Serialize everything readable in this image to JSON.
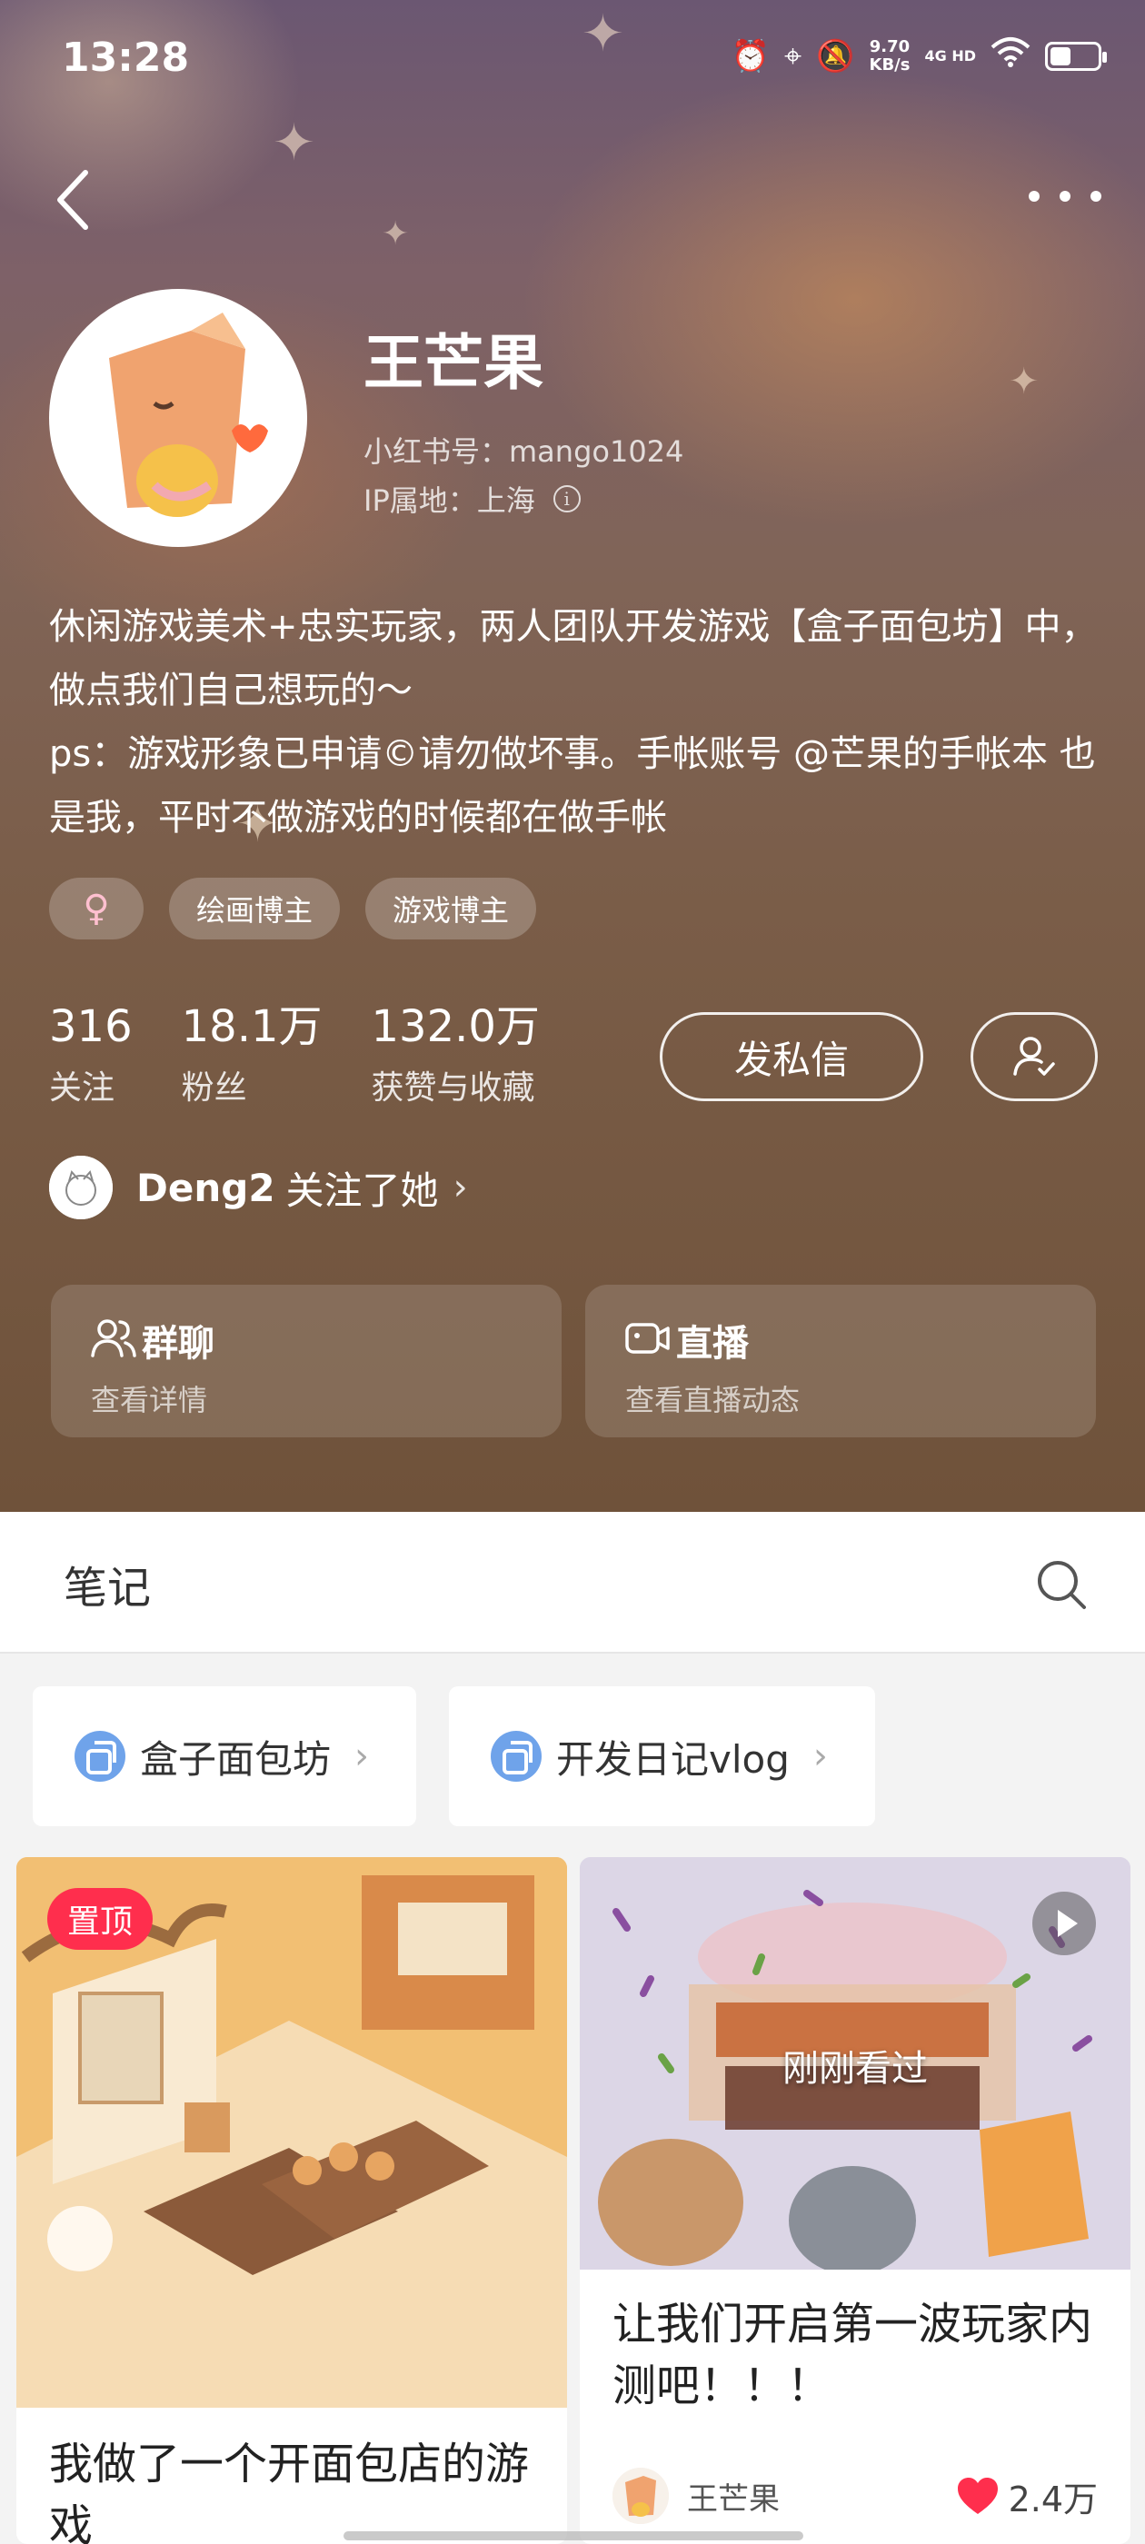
{
  "status_bar": {
    "time": "13:28",
    "speed_value": "9.70",
    "speed_unit": "KB/s",
    "network": "4G HD"
  },
  "profile": {
    "name": "王芒果",
    "red_id": "小红书号：mango1024",
    "ip_location": "IP属地：上海",
    "bio_line1": "休闲游戏美术+忠实玩家，两人团队开发游戏【盒子面包坊】中，做点我们自己想玩的～",
    "bio_line2": "ps：游戏形象已申请©请勿做坏事。手帐账号 @芒果的手帐本 也是我，平时不做游戏的时候都在做手帐",
    "tags": [
      "♀",
      "绘画博主",
      "游戏博主"
    ],
    "stats": {
      "following": {
        "value": "316",
        "label": "关注"
      },
      "followers": {
        "value": "18.1万",
        "label": "粉丝"
      },
      "likes": {
        "value": "132.0万",
        "label": "获赞与收藏"
      }
    },
    "message_button": "发私信",
    "followed_by": {
      "name": "Deng2",
      "text": "关注了她"
    },
    "cards": [
      {
        "title": "群聊",
        "subtitle": "查看详情",
        "icon": "group-icon"
      },
      {
        "title": "直播",
        "subtitle": "查看直播动态",
        "icon": "live-camera-icon"
      }
    ]
  },
  "tabbar": {
    "notes_label": "笔记"
  },
  "collections": [
    {
      "label": "盒子面包坊"
    },
    {
      "label": "开发日记vlog"
    }
  ],
  "feed": [
    {
      "badge": "置顶",
      "title": "我做了一个开面包店的游戏"
    },
    {
      "overlay": "刚刚看过",
      "title": "让我们开启第一波玩家内测吧！！！",
      "author": "王芒果",
      "likes": "2.4万"
    }
  ],
  "colors": {
    "accent_red": "#ff2e4d",
    "collection_icon_blue": "#6fa3ea",
    "header_brown": "#7a5d48"
  }
}
